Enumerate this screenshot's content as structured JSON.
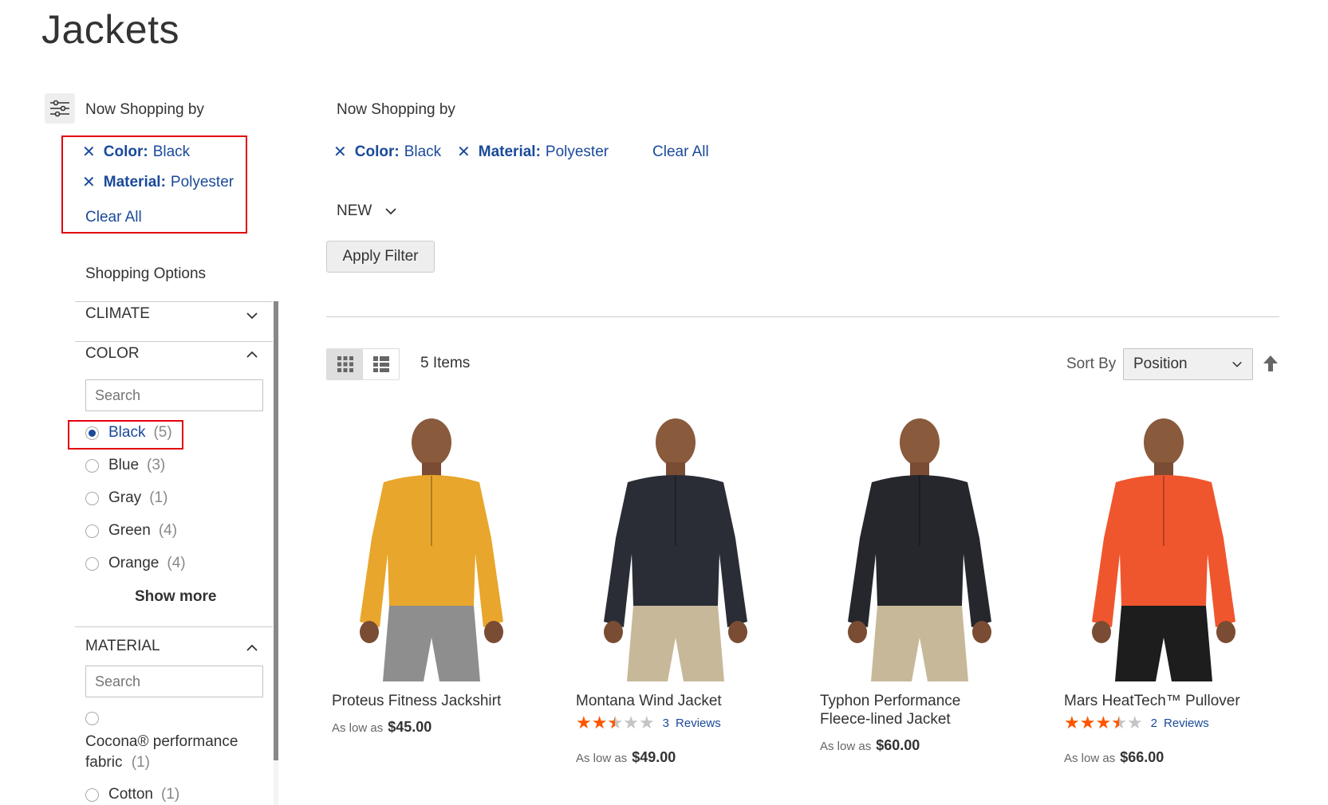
{
  "page_title": "Jackets",
  "sidebar": {
    "now_shopping_title": "Now Shopping by",
    "active_filters": [
      {
        "label": "Color:",
        "value": "Black"
      },
      {
        "label": "Material:",
        "value": "Polyester"
      }
    ],
    "clear_all": "Clear All",
    "shopping_options_title": "Shopping Options",
    "facets": {
      "climate": {
        "title": "CLIMATE"
      },
      "color": {
        "title": "COLOR",
        "search_placeholder": "Search",
        "options": [
          {
            "label": "Black",
            "count": "(5)",
            "selected": true
          },
          {
            "label": "Blue",
            "count": "(3)",
            "selected": false
          },
          {
            "label": "Gray",
            "count": "(1)",
            "selected": false
          },
          {
            "label": "Green",
            "count": "(4)",
            "selected": false
          },
          {
            "label": "Orange",
            "count": "(4)",
            "selected": false
          }
        ],
        "show_more": "Show more"
      },
      "material": {
        "title": "MATERIAL",
        "search_placeholder": "Search",
        "options": [
          {
            "label": "Cocona® performance fabric",
            "count": "(1)",
            "selected": false
          },
          {
            "label": "Cotton",
            "count": "(1)",
            "selected": false
          }
        ]
      }
    }
  },
  "main": {
    "now_shopping_title": "Now Shopping by",
    "active_filters": [
      {
        "label": "Color:",
        "value": "Black"
      },
      {
        "label": "Material:",
        "value": "Polyester"
      }
    ],
    "clear_all": "Clear All",
    "new_label": "NEW",
    "apply_filter": "Apply Filter",
    "items_count": "5 Items",
    "sort_label": "Sort By",
    "sort_value": "Position"
  },
  "products": [
    {
      "name": "Proteus Fitness Jackshirt",
      "as_low_as": "As low as",
      "price": "$45.00",
      "rating": null,
      "reviews": null,
      "colors": {
        "shirt": "#e8a62c",
        "pants": "#8e8e8e"
      }
    },
    {
      "name": "Montana Wind Jacket",
      "as_low_as": "As low as",
      "price": "$49.00",
      "rating": 2.5,
      "reviews": {
        "count": "3",
        "label": "Reviews"
      },
      "colors": {
        "shirt": "#2a2d35",
        "pants": "#c7b899"
      }
    },
    {
      "name": "Typhon Performance Fleece-lined Jacket",
      "as_low_as": "As low as",
      "price": "$60.00",
      "rating": null,
      "reviews": null,
      "colors": {
        "shirt": "#25272d",
        "pants": "#c7b899"
      }
    },
    {
      "name": "Mars HeatTech™ Pullover",
      "as_low_as": "As low as",
      "price": "$66.00",
      "rating": 3.5,
      "reviews": {
        "count": "2",
        "label": "Reviews"
      },
      "colors": {
        "shirt": "#f0562d",
        "pants": "#1d1d1d"
      }
    }
  ],
  "colors": {
    "link": "#1a4a9a",
    "highlight_box": "#e3000f",
    "star_on": "#ff5501",
    "star_off": "#c4c4c4"
  }
}
